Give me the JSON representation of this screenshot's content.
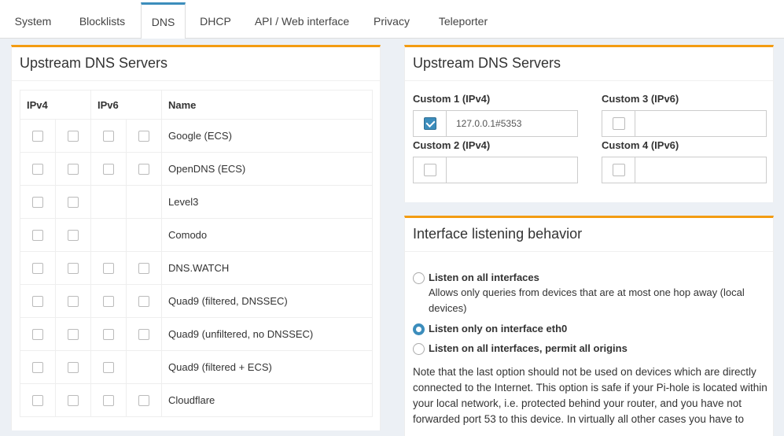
{
  "tabs": [
    {
      "label": "System"
    },
    {
      "label": "Blocklists"
    },
    {
      "label": "DNS"
    },
    {
      "label": "DHCP"
    },
    {
      "label": "API / Web interface"
    },
    {
      "label": "Privacy"
    },
    {
      "label": "Teleporter"
    }
  ],
  "active_tab": "DNS",
  "left_box": {
    "title": "Upstream DNS Servers",
    "headers": {
      "ipv4": "IPv4",
      "ipv6": "IPv6",
      "name": "Name"
    },
    "servers": [
      {
        "name": "Google (ECS)"
      },
      {
        "name": "OpenDNS (ECS)"
      },
      {
        "name": "Level3"
      },
      {
        "name": "Comodo"
      },
      {
        "name": "DNS.WATCH"
      },
      {
        "name": "Quad9 (filtered, DNSSEC)"
      },
      {
        "name": "Quad9 (unfiltered, no DNSSEC)"
      },
      {
        "name": "Quad9 (filtered + ECS)"
      },
      {
        "name": "Cloudflare"
      }
    ]
  },
  "right_box": {
    "title": "Upstream DNS Servers",
    "custom1": {
      "label": "Custom 1 (IPv4)",
      "value": "127.0.0.1#5353",
      "checked": true
    },
    "custom2": {
      "label": "Custom 2 (IPv4)",
      "value": "",
      "checked": false
    },
    "custom3": {
      "label": "Custom 3 (IPv6)",
      "value": "",
      "checked": false
    },
    "custom4": {
      "label": "Custom 4 (IPv6)",
      "value": "",
      "checked": false
    }
  },
  "interface_box": {
    "title": "Interface listening behavior",
    "options": [
      {
        "label": "Listen on all interfaces",
        "desc": "Allows only queries from devices that are at most one hop away (local devices)"
      },
      {
        "label": "Listen only on interface eth0"
      },
      {
        "label": "Listen on all interfaces, permit all origins"
      }
    ],
    "note": "Note that the last option should not be used on devices which are directly connected to the Internet. This option is safe if your Pi-hole is located within your local network, i.e. protected behind your router, and you have not forwarded port 53 to this device. In virtually all other cases you have to"
  },
  "colors": {
    "accent": "#3c8dbc",
    "box_border": "#f39c12"
  }
}
